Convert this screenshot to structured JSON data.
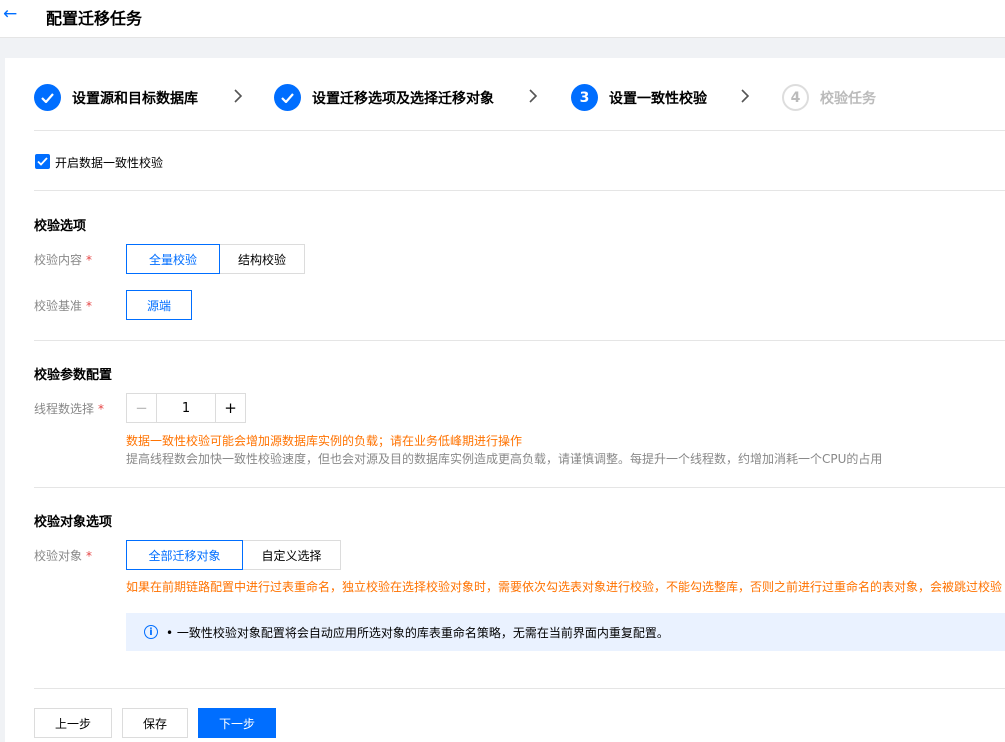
{
  "header": {
    "title": "配置迁移任务"
  },
  "steps": [
    {
      "label": "设置源和目标数据库",
      "state": "done"
    },
    {
      "label": "设置迁移选项及选择迁移对象",
      "state": "done"
    },
    {
      "label": "设置一致性校验",
      "state": "active",
      "number": "3"
    },
    {
      "label": "校验任务",
      "state": "pending",
      "number": "4"
    }
  ],
  "enable_check": {
    "label": "开启数据一致性校验",
    "checked": true
  },
  "check_options": {
    "title": "校验选项",
    "content": {
      "label": "校验内容",
      "required_mark": "*",
      "options": [
        "全量校验",
        "结构校验"
      ],
      "selected": "全量校验"
    },
    "baseline": {
      "label": "校验基准",
      "required_mark": "*",
      "options": [
        "源端"
      ],
      "selected": "源端"
    }
  },
  "params": {
    "title": "校验参数配置",
    "threads": {
      "label": "线程数选择",
      "required_mark": "*",
      "minus": "−",
      "plus": "+",
      "value": "1"
    },
    "warning": "数据一致性校验可能会增加源数据库实例的负载；请在业务低峰期进行操作",
    "hint": "提高线程数会加快一致性校验速度，但也会对源及目的数据库实例造成更高负载，请谨慎调整。每提升一个线程数，约增加消耗一个CPU的占用"
  },
  "objects": {
    "title": "校验对象选项",
    "field": {
      "label": "校验对象",
      "required_mark": "*",
      "options": [
        "全部迁移对象",
        "自定义选择"
      ],
      "selected": "全部迁移对象"
    },
    "warning": "如果在前期链路配置中进行过表重命名，独立校验在选择校验对象时，需要依次勾选表对象进行校验，不能勾选整库，否则之前进行过重命名的表对象，会被跳过校验",
    "info": {
      "icon_glyph": "i",
      "text": "• 一致性校验对象配置将会自动应用所选对象的库表重命名策略，无需在当前界面内重复配置。"
    }
  },
  "footer": {
    "prev": "上一步",
    "save": "保存",
    "next": "下一步"
  },
  "colors": {
    "primary": "#006eff",
    "warning": "#ff7200",
    "required": "#e54545",
    "info_bg": "#eaf2ff"
  }
}
